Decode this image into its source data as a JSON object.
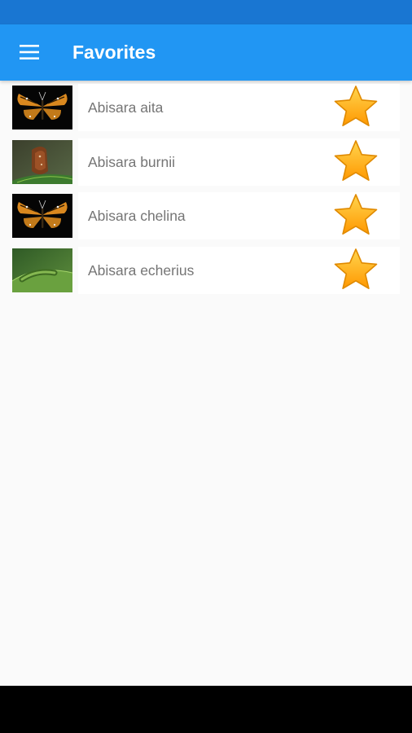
{
  "app_bar": {
    "title": "Favorites",
    "menu_icon": "hamburger-menu-icon",
    "background": "#2196f3",
    "status_bar_color": "#1976d2"
  },
  "favorites": [
    {
      "name": "Abisara aita",
      "thumb": "butterfly-orange-on-black",
      "favorited": true
    },
    {
      "name": "Abisara burnii",
      "thumb": "butterfly-brown-on-leaf",
      "favorited": true
    },
    {
      "name": "Abisara chelina",
      "thumb": "butterfly-orange-on-black",
      "favorited": true
    },
    {
      "name": "Abisara echerius",
      "thumb": "caterpillar-on-leaf",
      "favorited": true
    }
  ],
  "colors": {
    "star_fill": "#ffb300",
    "name_text": "#757575"
  }
}
